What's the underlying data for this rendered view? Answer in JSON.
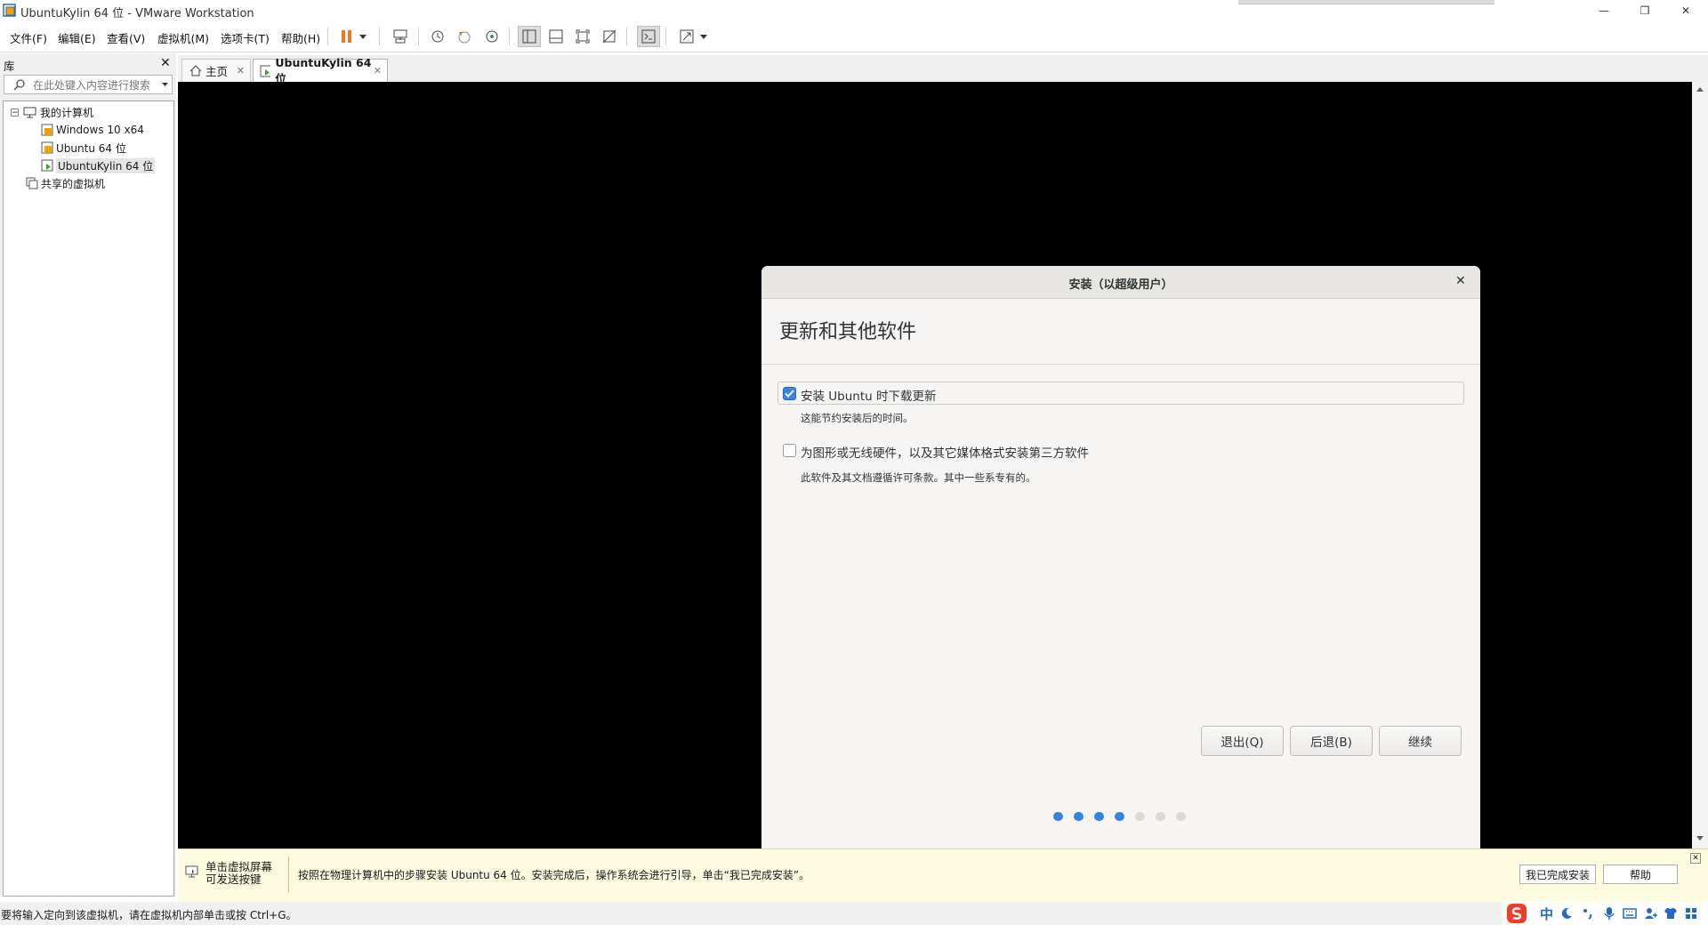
{
  "window": {
    "title": "UbuntuKylin 64 位 - VMware Workstation",
    "minimize_glyph": "—",
    "restore_glyph": "❐",
    "close_glyph": "✕"
  },
  "menu": [
    "文件(F)",
    "编辑(E)",
    "查看(V)",
    "虚拟机(M)",
    "选项卡(T)",
    "帮助(H)"
  ],
  "library": {
    "title": "库",
    "close_glyph": "✕",
    "search_placeholder": "在此处键入内容进行搜索",
    "tree": {
      "root": "我的计算机",
      "vms": [
        "Windows 10 x64",
        "Ubuntu 64 位",
        "UbuntuKylin 64 位"
      ],
      "selected": "UbuntuKylin 64 位",
      "shared": "共享的虚拟机"
    }
  },
  "tabs": [
    {
      "label": "主页",
      "close": "✕",
      "active": false
    },
    {
      "label": "UbuntuKylin 64 位",
      "close": "✕",
      "active": true
    }
  ],
  "dialog": {
    "title": "安装（以超级用户）",
    "close_glyph": "✕",
    "heading": "更新和其他软件",
    "options": [
      {
        "label": "安装 Ubuntu 时下载更新",
        "description": "这能节约安装后的时间。",
        "checked": true
      },
      {
        "label": "为图形或无线硬件，以及其它媒体格式安装第三方软件",
        "description": "此软件及其文档遵循许可条款。其中一些系专有的。",
        "checked": false
      }
    ],
    "buttons": {
      "quit": "退出(Q)",
      "back": "后退(B)",
      "continue": "继续"
    },
    "progress": {
      "current_step": 4,
      "total_steps": 7
    }
  },
  "hint_bar": {
    "click_hint": "单击虚拟屏幕\n可发送按键",
    "message": "按照在物理计算机中的步骤安装 Ubuntu 64 位。安装完成后，操作系统会进行引导，单击“我已完成安装”。",
    "done_button": "我已完成安装",
    "help_button": "帮助",
    "close_glyph": "✕"
  },
  "status_bar": {
    "text": "要将输入定向到该虚拟机，请在虚拟机内部单击或按 Ctrl+G。",
    "ime_label": "中"
  },
  "colors": {
    "pause_accent": "#f07820",
    "checkbox_blue": "#3584e4",
    "dot_active": "#3584e4",
    "dot_inactive": "#dcdad7",
    "ime_logo": "#e8402a"
  }
}
